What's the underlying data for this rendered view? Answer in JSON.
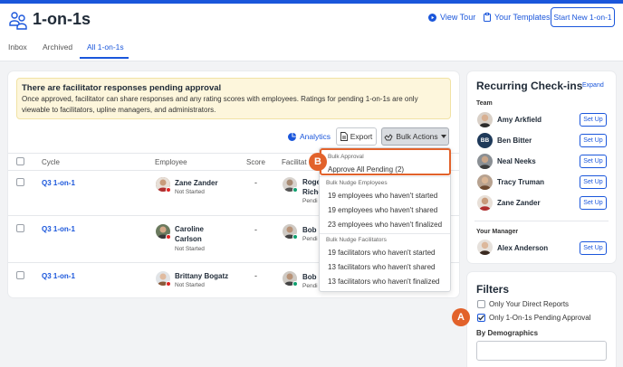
{
  "header": {
    "title": "1-on-1s",
    "view_tour": "View Tour",
    "your_templates": "Your Templates",
    "start_new": "Start New 1-on-1"
  },
  "tabs": [
    {
      "label": "Inbox"
    },
    {
      "label": "Archived"
    },
    {
      "label": "All 1-on-1s",
      "active": true
    }
  ],
  "banner": {
    "title": "There are facilitator responses pending approval",
    "text": "Once approved, facilitator can share responses and any rating scores with employees. Ratings for pending 1-on-1s are only viewable to facilitators, upline managers, and administrators."
  },
  "toolbar": {
    "analytics": "Analytics",
    "export": "Export",
    "bulk_actions": "Bulk Actions"
  },
  "table": {
    "columns": [
      "Cycle",
      "Employee",
      "Score",
      "Facilitat"
    ],
    "rows": [
      {
        "cycle": "Q3 1-on-1",
        "employee": "Zane Zander",
        "employee_status": "Not Started",
        "score": "-",
        "facilitator_line1": "Roge",
        "facilitator_line2": "Riche",
        "facilitator_status": "Pendi"
      },
      {
        "cycle": "Q3 1-on-1",
        "employee_line1": "Caroline",
        "employee_line2": "Carlson",
        "employee_status": "Not Started",
        "score": "-",
        "facilitator_line1": "Bob",
        "facilitator_status": "Pendi"
      },
      {
        "cycle": "Q3 1-on-1",
        "employee": "Brittany Bogatz",
        "employee_status": "Not Started",
        "score": "-",
        "facilitator_line1": "Bob",
        "facilitator_status": "Pendi"
      }
    ]
  },
  "dropdown": {
    "group_approval": "Bulk Approval",
    "approve_all": "Approve All Pending (2)",
    "group_employees": "Bulk Nudge Employees",
    "emp_not_started": "19 employees who haven't started",
    "emp_not_shared": "19 employees who haven't shared",
    "emp_not_finalized": "23 employees who haven't finalized",
    "group_facilitators": "Bulk Nudge Facilitators",
    "fac_not_started": "19 facilitators who haven't started",
    "fac_not_shared": "13 facilitators who haven't shared",
    "fac_not_finalized": "13 facilitators who haven't finalized"
  },
  "badges": {
    "a": "A",
    "b": "B"
  },
  "recurring": {
    "title": "Recurring Check-ins",
    "expand": "Expand",
    "team_label": "Team",
    "setup": "Set Up",
    "team": [
      {
        "name": "Amy Arkfield"
      },
      {
        "name": "Ben Bitter",
        "initials": "BB"
      },
      {
        "name": "Neal Neeks"
      },
      {
        "name": "Tracy Truman"
      },
      {
        "name": "Zane Zander"
      }
    ],
    "manager_label": "Your Manager",
    "manager": {
      "name": "Alex Anderson"
    }
  },
  "filters": {
    "title": "Filters",
    "direct_reports": "Only Your Direct Reports",
    "pending_approval": "Only 1-On-1s Pending Approval",
    "pending_checked": true,
    "demographics_label": "By Demographics"
  },
  "colors": {
    "accent": "#1a56db",
    "highlight": "#e2622b",
    "banner_bg": "#fdf6dc"
  }
}
